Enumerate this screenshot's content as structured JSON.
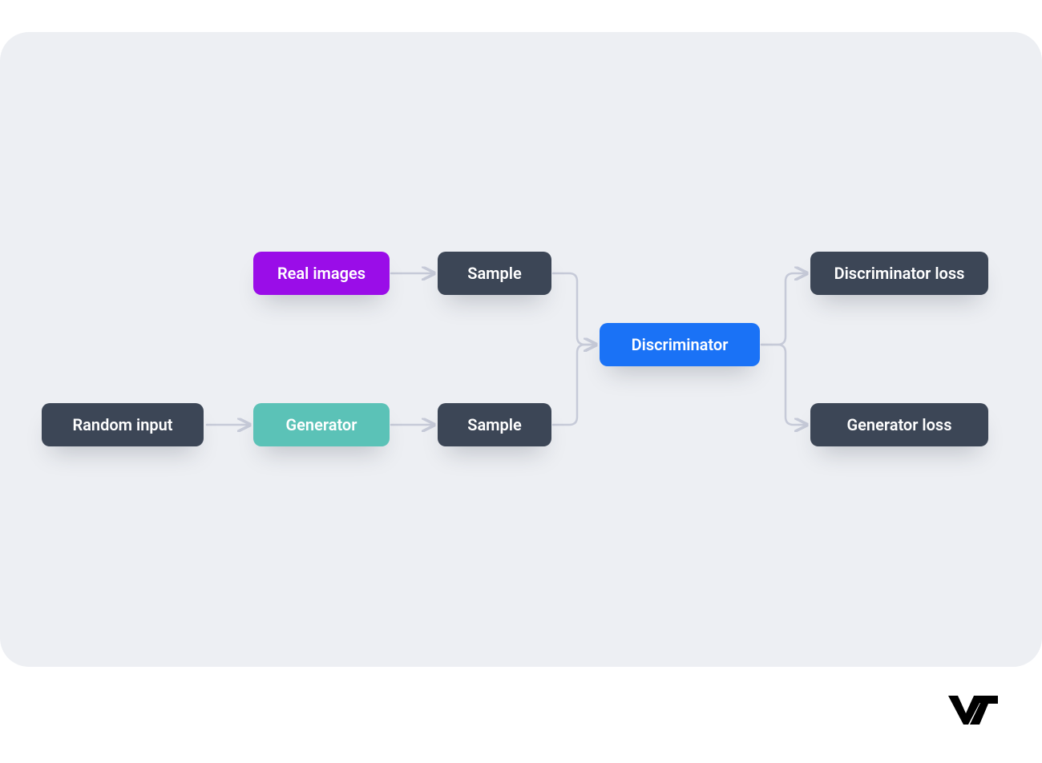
{
  "nodes": {
    "random_input": {
      "label": "Random input"
    },
    "real_images": {
      "label": "Real images"
    },
    "generator": {
      "label": "Generator"
    },
    "sample_top": {
      "label": "Sample"
    },
    "sample_bottom": {
      "label": "Sample"
    },
    "discriminator": {
      "label": "Discriminator"
    },
    "discriminator_loss": {
      "label": "Discriminator loss"
    },
    "generator_loss": {
      "label": "Generator loss"
    }
  },
  "branding": {
    "logo_text": "V7"
  },
  "colors": {
    "bg": "#edeff3",
    "dark": "#3c4656",
    "purple": "#9a0de8",
    "teal": "#5bc2b7",
    "blue": "#1a72f6",
    "arrow": "#c6cad8"
  }
}
